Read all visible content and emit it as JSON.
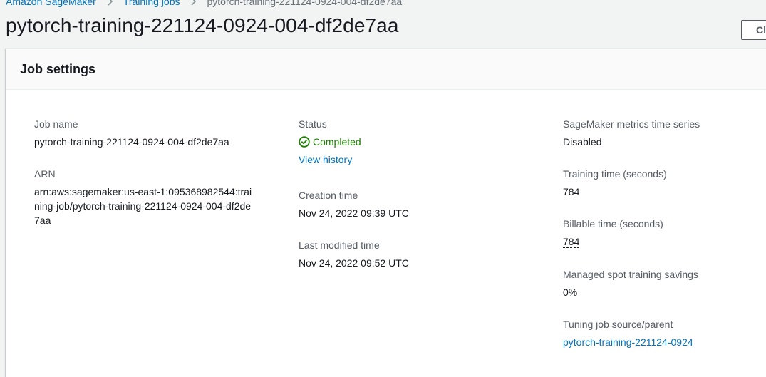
{
  "breadcrumb": {
    "items": [
      "Amazon SageMaker",
      "Training jobs"
    ],
    "current": "pytorch-training-221124-0924-004-df2de7aa"
  },
  "page": {
    "title": "pytorch-training-221124-0924-004-df2de7aa",
    "action_button_label": "Cl"
  },
  "panel": {
    "title": "Job settings",
    "job_name_label": "Job name",
    "job_name_value": "pytorch-training-221124-0924-004-df2de7aa",
    "arn_label": "ARN",
    "arn_value": "arn:aws:sagemaker:us-east-1:095368982544:training-job/pytorch-training-221124-0924-004-df2de7aa",
    "status_label": "Status",
    "status_value": "Completed",
    "status_icon": "check-circle-icon",
    "status_color": "#1d8102",
    "view_history_link": "View history",
    "creation_time_label": "Creation time",
    "creation_time_value": "Nov 24, 2022 09:39 UTC",
    "last_modified_label": "Last modified time",
    "last_modified_value": "Nov 24, 2022 09:52 UTC",
    "metrics_label": "SageMaker metrics time series",
    "metrics_value": "Disabled",
    "training_time_label": "Training time (seconds)",
    "training_time_value": "784",
    "billable_time_label": "Billable time (seconds)",
    "billable_time_value": "784",
    "spot_savings_label": "Managed spot training savings",
    "spot_savings_value": "0%",
    "tuning_job_label": "Tuning job source/parent",
    "tuning_job_link": "pytorch-training-221124-0924"
  },
  "colors": {
    "link": "#0073bb",
    "background": "#f2f3f3",
    "success": "#1d8102"
  }
}
